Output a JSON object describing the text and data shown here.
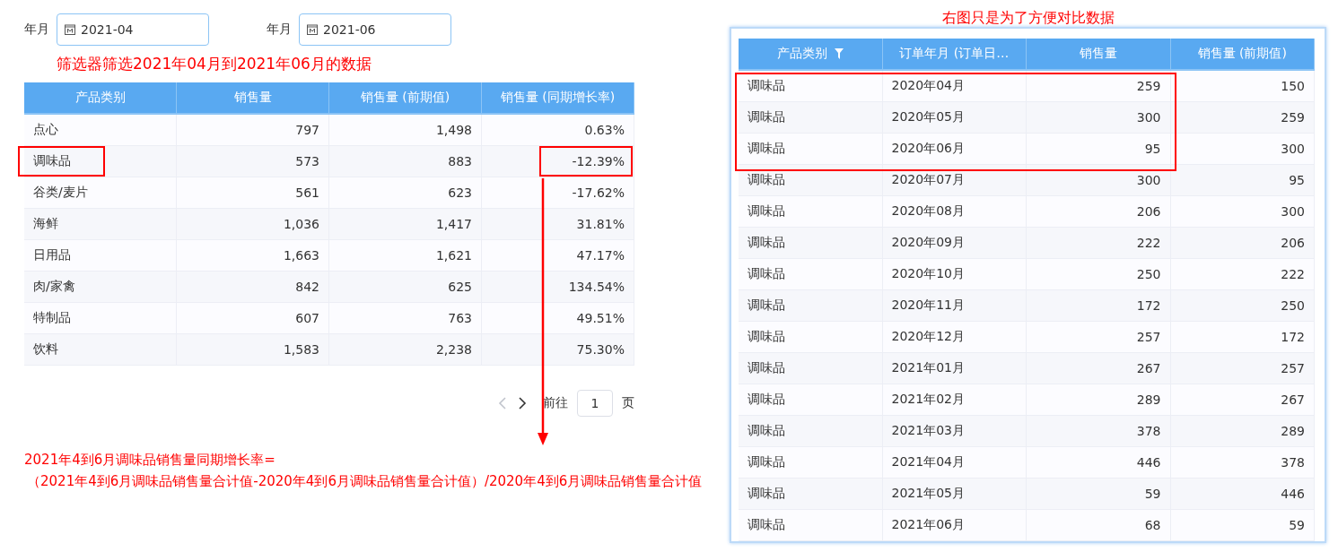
{
  "filters": [
    {
      "label": "年月",
      "value": "2021-04"
    },
    {
      "label": "年月",
      "value": "2021-06"
    }
  ],
  "filter_note": "筛选器筛选2021年04月到2021年06月的数据",
  "left_table": {
    "columns": [
      "产品类别",
      "销售量",
      "销售量 (前期值)",
      "销售量 (同期增长率)"
    ],
    "rows": [
      {
        "cells": [
          "点心",
          "797",
          "1,498",
          "0.63%"
        ],
        "highlighted": false
      },
      {
        "cells": [
          "调味品",
          "573",
          "883",
          "-12.39%"
        ],
        "highlighted": true
      },
      {
        "cells": [
          "谷类/麦片",
          "561",
          "623",
          "-17.62%"
        ],
        "highlighted": false
      },
      {
        "cells": [
          "海鲜",
          "1,036",
          "1,417",
          "31.81%"
        ],
        "highlighted": false
      },
      {
        "cells": [
          "日用品",
          "1,663",
          "1,621",
          "47.17%"
        ],
        "highlighted": false
      },
      {
        "cells": [
          "肉/家禽",
          "842",
          "625",
          "134.54%"
        ],
        "highlighted": false
      },
      {
        "cells": [
          "特制品",
          "607",
          "763",
          "49.51%"
        ],
        "highlighted": false
      },
      {
        "cells": [
          "饮料",
          "1,583",
          "2,238",
          "75.30%"
        ],
        "highlighted": false
      }
    ]
  },
  "pagination": {
    "prev_disabled": true,
    "next_disabled": false,
    "goto_label": "前往",
    "page": "1",
    "page_suffix": "页"
  },
  "formula_lines": [
    "2021年4到6月调味品销售量同期增长率=",
    "（2021年4到6月调味品销售量合计值-2020年4到6月调味品销售量合计值）/2020年4到6月调味品销售量合计值"
  ],
  "compare_note": "右图只是为了方便对比数据",
  "right_table": {
    "columns": [
      {
        "label": "产品类别",
        "filter": true
      },
      {
        "label": "订单年月 (订单日…",
        "filter": false
      },
      {
        "label": "销售量",
        "filter": false
      },
      {
        "label": "销售量 (前期值)",
        "filter": false
      }
    ],
    "rows": [
      {
        "cells": [
          "调味品",
          "2020年04月",
          "259",
          "150"
        ],
        "highlighted": true
      },
      {
        "cells": [
          "调味品",
          "2020年05月",
          "300",
          "259"
        ],
        "highlighted": true
      },
      {
        "cells": [
          "调味品",
          "2020年06月",
          "95",
          "300"
        ],
        "highlighted": true
      },
      {
        "cells": [
          "调味品",
          "2020年07月",
          "300",
          "95"
        ],
        "highlighted": false
      },
      {
        "cells": [
          "调味品",
          "2020年08月",
          "206",
          "300"
        ],
        "highlighted": false
      },
      {
        "cells": [
          "调味品",
          "2020年09月",
          "222",
          "206"
        ],
        "highlighted": false
      },
      {
        "cells": [
          "调味品",
          "2020年10月",
          "250",
          "222"
        ],
        "highlighted": false
      },
      {
        "cells": [
          "调味品",
          "2020年11月",
          "172",
          "250"
        ],
        "highlighted": false
      },
      {
        "cells": [
          "调味品",
          "2020年12月",
          "257",
          "172"
        ],
        "highlighted": false
      },
      {
        "cells": [
          "调味品",
          "2021年01月",
          "267",
          "257"
        ],
        "highlighted": false
      },
      {
        "cells": [
          "调味品",
          "2021年02月",
          "289",
          "267"
        ],
        "highlighted": false
      },
      {
        "cells": [
          "调味品",
          "2021年03月",
          "378",
          "289"
        ],
        "highlighted": false
      },
      {
        "cells": [
          "调味品",
          "2021年04月",
          "446",
          "378"
        ],
        "highlighted": false
      },
      {
        "cells": [
          "调味品",
          "2021年05月",
          "59",
          "446"
        ],
        "highlighted": false
      },
      {
        "cells": [
          "调味品",
          "2021年06月",
          "68",
          "59"
        ],
        "highlighted": false
      }
    ]
  }
}
